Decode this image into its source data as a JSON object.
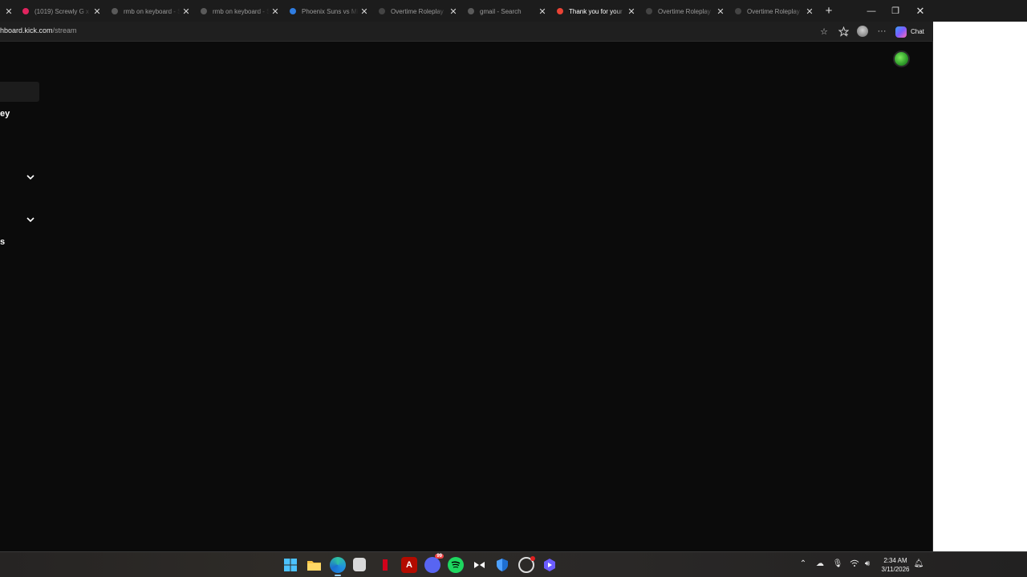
{
  "tabs": [
    {
      "title": "(1019) Screwly G x B",
      "favicon_color": "#e0245e",
      "active": false
    },
    {
      "title": "rmb on keyboard - S",
      "favicon_color": "#5a5a5a",
      "active": false
    },
    {
      "title": "rmb on keyboard - S",
      "favicon_color": "#5a5a5a",
      "active": false
    },
    {
      "title": "Phoenix Suns vs Mi",
      "favicon_color": "#2f7de1",
      "active": false
    },
    {
      "title": "Overtime Roleplay",
      "favicon_color": "#444444",
      "active": false
    },
    {
      "title": "gmail - Search",
      "favicon_color": "#5a5a5a",
      "active": false
    },
    {
      "title": "Thank you for your",
      "favicon_color": "#ea4335",
      "active": true
    },
    {
      "title": "Overtime Roleplay",
      "favicon_color": "#444444",
      "active": false
    },
    {
      "title": "Overtime Roleplay",
      "favicon_color": "#444444",
      "active": false
    }
  ],
  "toolbar": {
    "address_host": "hboard.kick.com",
    "address_path": "/stream",
    "chat_label": "Chat"
  },
  "sidebar": {
    "item_1_label": "ey",
    "item_2_label": "s"
  },
  "taskbar": {
    "time": "2:34 AM",
    "date": "3/11/2026"
  }
}
